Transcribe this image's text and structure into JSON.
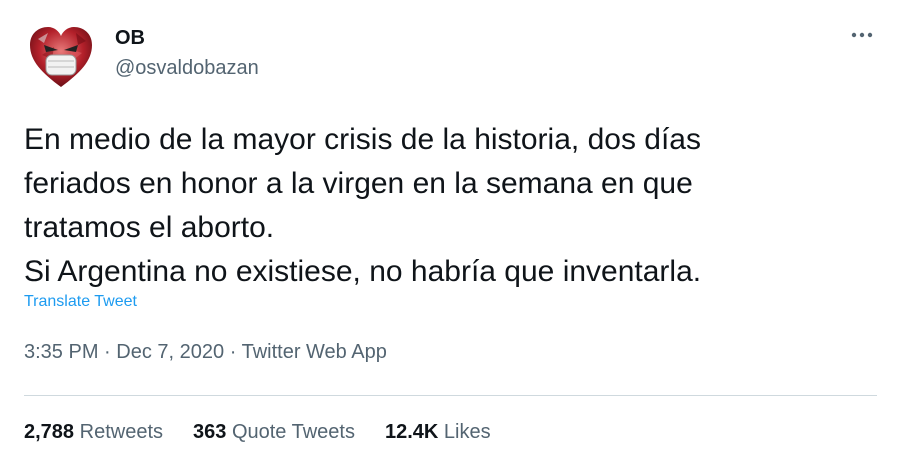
{
  "user": {
    "display_name": "OB",
    "handle": "@osvaldobazan",
    "avatar_icon": "heart-mask-character-icon"
  },
  "tweet": {
    "lines": [
      "En medio de la mayor crisis de la historia, dos días",
      "feriados en honor a la virgen en la semana en que",
      "tratamos el aborto.",
      "Si Argentina no existiese, no habría que inventarla."
    ],
    "translate_label": "Translate Tweet",
    "time": "3:35 PM",
    "date": "Dec 7, 2020",
    "separator": "·",
    "source": "Twitter Web App"
  },
  "stats": {
    "retweets_count": "2,788",
    "retweets_label": "Retweets",
    "quotes_count": "363",
    "quotes_label": "Quote Tweets",
    "likes_count": "12.4K",
    "likes_label": "Likes"
  },
  "more_icon": "more-dots-icon",
  "colors": {
    "text": "#0f1419",
    "secondary": "#536471",
    "link": "#1d9bf0",
    "divider": "#cfd9de"
  }
}
